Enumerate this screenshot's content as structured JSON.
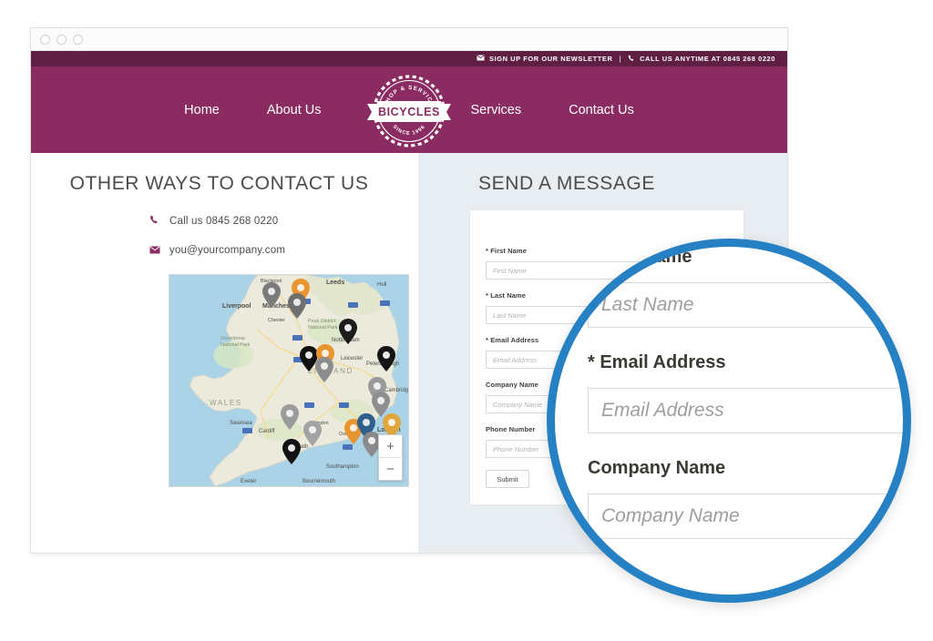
{
  "browser": {
    "dots": [
      "close-dot",
      "minimize-dot",
      "maximize-dot"
    ]
  },
  "site": {
    "topbar": {
      "newsletter_icon": "envelope-icon",
      "newsletter_text": "SIGN UP FOR OUR NEWSLETTER",
      "separator": "|",
      "phone_icon": "phone-icon",
      "phone_text": "CALL US ANYTIME AT 0845 268 0220"
    },
    "nav": {
      "links_left": [
        "Home",
        "About Us"
      ],
      "links_right": [
        "Services",
        "Contact Us"
      ],
      "logo": {
        "top_text": "SHOP & SERVICE",
        "main_text": "BICYCLES",
        "bottom_text": "SINCE 1996"
      }
    },
    "colors": {
      "brand_purple": "#8a2b62",
      "topbar_purple": "#5f1f43",
      "panel_bg": "#e8edf1",
      "magnifier_ring": "#2581c4"
    }
  },
  "left_column": {
    "heading": "OTHER WAYS TO CONTACT US",
    "contacts": [
      {
        "icon": "phone-icon",
        "text": "Call us 0845 268 0220"
      },
      {
        "icon": "envelope-icon",
        "text": "you@yourcompany.com"
      }
    ],
    "map": {
      "labels": [
        "Leeds",
        "Hull",
        "Liverpool",
        "Manchester",
        "Nottingham",
        "Leicester",
        "Peterborough",
        "Cambridge",
        "London",
        "ENGLAND",
        "WALES",
        "Cardiff",
        "Swansea",
        "Bath",
        "Exeter",
        "Southampton",
        "Bournemouth",
        "Peak District National Park",
        "Snowdonia National Park",
        "Chester",
        "Swindon",
        "Blackpool",
        "Oxford"
      ],
      "zoom_in": "+",
      "zoom_out": "−"
    }
  },
  "right_column": {
    "heading": "SEND A MESSAGE",
    "fields": [
      {
        "label": "* First Name",
        "placeholder": "First Name",
        "value": ""
      },
      {
        "label": "* Last Name",
        "placeholder": "Last Name",
        "value": ""
      },
      {
        "label": "* Email Address",
        "placeholder": "Email Address",
        "value": ""
      },
      {
        "label": "Company Name",
        "placeholder": "Company Name",
        "value": ""
      },
      {
        "label": "Phone Number",
        "placeholder": "Phone Number",
        "value": ""
      }
    ],
    "submit_label": "Submit"
  },
  "magnifier": {
    "fields": [
      {
        "label": "* Last Name",
        "placeholder": "Last Name"
      },
      {
        "label": "* Email Address",
        "placeholder": "Email Address"
      },
      {
        "label": "Company Name",
        "placeholder": "Company Name"
      }
    ]
  }
}
